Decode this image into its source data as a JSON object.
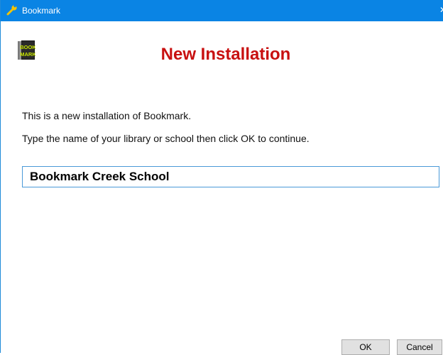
{
  "window": {
    "title": "Bookmark",
    "title_icon": "wrench-icon",
    "close_glyph": "✕"
  },
  "logo": {
    "icon": "bookmark-logo-icon",
    "text_top": "BOOK",
    "text_bottom": "MARK"
  },
  "content": {
    "heading": "New Installation",
    "line1": "This is a new installation of Bookmark.",
    "line2": "Type the name of your library or school then click OK to continue."
  },
  "name_input": {
    "value": "Bookmark Creek School"
  },
  "buttons": {
    "ok_label": "OK",
    "cancel_label": "Cancel"
  },
  "colors": {
    "titlebar": "#0a84e4",
    "heading": "#c81010",
    "input_border": "#4a9ad8"
  }
}
